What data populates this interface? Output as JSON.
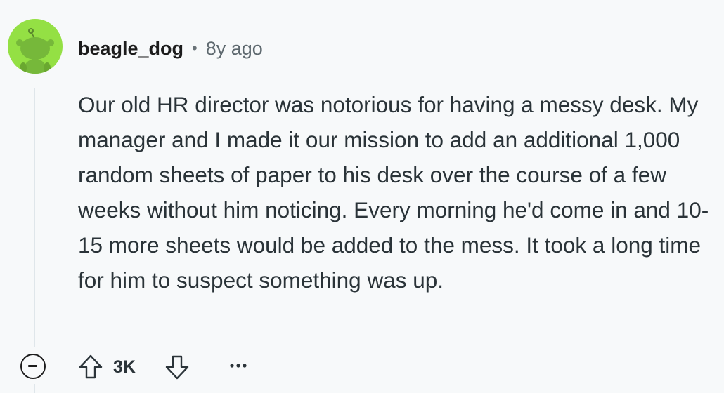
{
  "comment": {
    "author": "beagle_dog",
    "separator": "•",
    "age": "8y ago",
    "body": "Our old HR director was notorious for having a messy desk. My manager and I made it our mission to add an additional 1,000 random sheets of paper to his desk over the course of a few weeks without him noticing. Every morning he'd come in and 10-15 more sheets would be added to the mess. It took a long time for him to suspect something was up.",
    "score": "3K"
  },
  "icons": {
    "avatar": "snoo-avatar",
    "collapse": "collapse-icon",
    "upvote": "upvote-icon",
    "downvote": "downvote-icon",
    "more": "more-options-icon"
  },
  "colors": {
    "background": "#f7f9fa",
    "avatar_bg": "#94e044",
    "thread_line": "#dfe6ea",
    "text": "#2a3338"
  }
}
